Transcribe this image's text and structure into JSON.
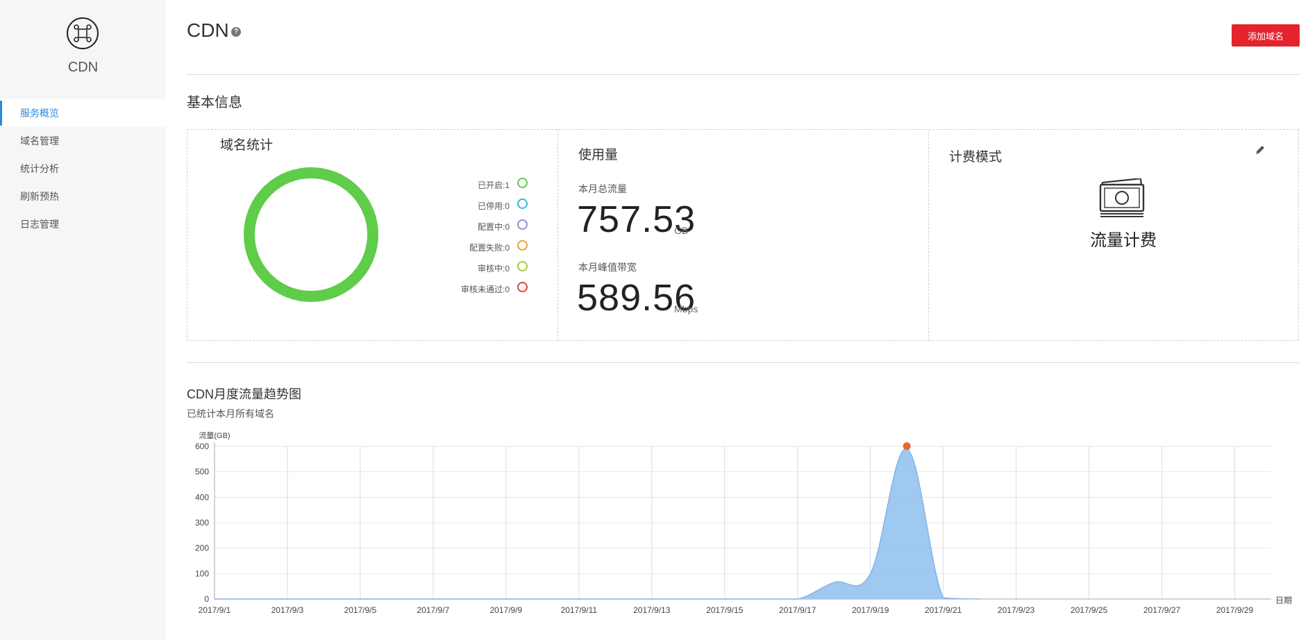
{
  "sidebar": {
    "title": "CDN",
    "logo_icon": "cdn-network-icon",
    "items": [
      {
        "label": "服务概览",
        "active": true
      },
      {
        "label": "域名管理",
        "active": false
      },
      {
        "label": "统计分析",
        "active": false
      },
      {
        "label": "刷新预热",
        "active": false
      },
      {
        "label": "日志管理",
        "active": false
      }
    ]
  },
  "header": {
    "title": "CDN",
    "help_icon": "question-circle-icon",
    "add_button": "添加域名"
  },
  "basic_info": {
    "title": "基本信息",
    "domain_stats": {
      "title": "域名统计",
      "ring_color": "#5fcc4a",
      "legend": [
        {
          "label": "已开启:1",
          "color": "#5fcc4a"
        },
        {
          "label": "已停用:0",
          "color": "#34b9dd"
        },
        {
          "label": "配置中:0",
          "color": "#9a8bd6"
        },
        {
          "label": "配置失败:0",
          "color": "#f0a030"
        },
        {
          "label": "审核中:0",
          "color": "#a5cc3a"
        },
        {
          "label": "审核未通过:0",
          "color": "#e8413b"
        }
      ]
    },
    "usage": {
      "title": "使用量",
      "traffic_label": "本月总流量",
      "traffic_value": "757.53",
      "traffic_unit": "GB",
      "bandwidth_label": "本月峰值带宽",
      "bandwidth_value": "589.56",
      "bandwidth_unit": "Mbps"
    },
    "billing": {
      "title": "计费模式",
      "edit_icon": "pencil-icon",
      "icon": "money-bills-icon",
      "mode": "流量计费"
    }
  },
  "chart_section": {
    "title": "CDN月度流量趋势图",
    "subtitle": "已统计本月所有域名"
  },
  "chart_data": {
    "type": "area",
    "title": "",
    "ylabel": "流量(GB)",
    "xlabel": "日期",
    "ylim": [
      0,
      600
    ],
    "yticks": [
      0,
      100,
      200,
      300,
      400,
      500,
      600
    ],
    "xtick_labels": [
      "2017/9/1",
      "2017/9/3",
      "2017/9/5",
      "2017/9/7",
      "2017/9/9",
      "2017/9/11",
      "2017/9/13",
      "2017/9/15",
      "2017/9/17",
      "2017/9/19",
      "2017/9/21",
      "2017/9/23",
      "2017/9/25",
      "2017/9/27",
      "2017/9/29"
    ],
    "x": [
      1,
      2,
      3,
      4,
      5,
      6,
      7,
      8,
      9,
      10,
      11,
      12,
      13,
      14,
      15,
      16,
      17,
      18,
      19,
      20,
      21,
      22
    ],
    "series": [
      {
        "values": [
          0,
          0,
          0,
          0,
          0,
          0,
          0,
          0,
          0,
          0,
          0,
          0,
          0,
          0,
          0,
          0,
          0,
          65,
          100,
          590,
          5,
          0
        ],
        "color": "#8fbfee",
        "peak_marker_color": "#e8672a"
      }
    ],
    "grid": true
  }
}
